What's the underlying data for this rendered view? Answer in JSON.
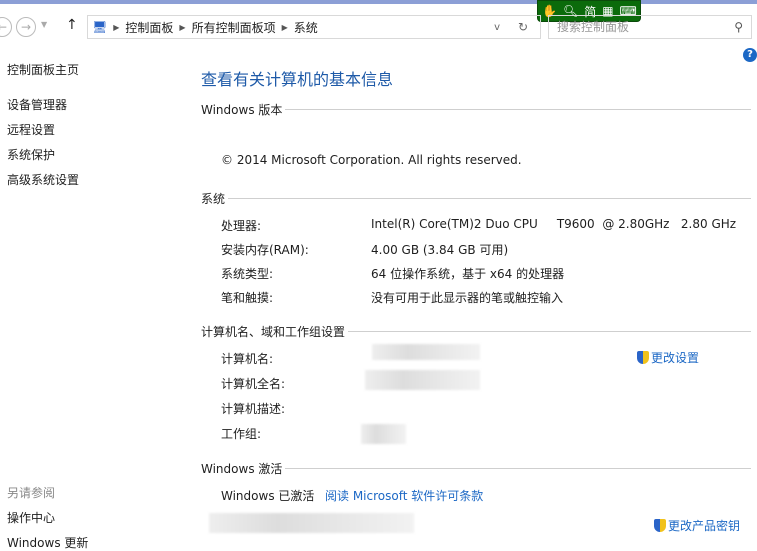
{
  "nav": {
    "breadcrumb": [
      "控制面板",
      "所有控制面板项",
      "系统"
    ],
    "search_placeholder": "搜索控制面板"
  },
  "ime": {
    "mode": "简"
  },
  "sidebar": {
    "home": "控制面板主页",
    "items": [
      "设备管理器",
      "远程设置",
      "系统保护",
      "高级系统设置"
    ],
    "see_also": "另请参阅",
    "bottom": [
      "操作中心",
      "Windows 更新"
    ]
  },
  "main": {
    "title": "查看有关计算机的基本信息",
    "edition": {
      "header": "Windows 版本",
      "copyright": "© 2014 Microsoft Corporation. All rights reserved."
    },
    "system": {
      "header": "系统",
      "rows": [
        {
          "label": "处理器:",
          "value": "Intel(R) Core(TM)2 Duo CPU     T9600  @ 2.80GHz   2.80 GHz"
        },
        {
          "label": "安装内存(RAM):",
          "value": "4.00 GB (3.84 GB 可用)"
        },
        {
          "label": "系统类型:",
          "value": "64 位操作系统，基于 x64 的处理器"
        },
        {
          "label": "笔和触摸:",
          "value": "没有可用于此显示器的笔或触控输入"
        }
      ]
    },
    "computer": {
      "header": "计算机名、域和工作组设置",
      "labels": [
        "计算机名:",
        "计算机全名:",
        "计算机描述:",
        "工作组:"
      ],
      "change_link": "更改设置"
    },
    "activation": {
      "header": "Windows 激活",
      "status": "Windows 已激活",
      "license_link": "阅读 Microsoft 软件许可条款",
      "change_key": "更改产品密钥"
    }
  }
}
